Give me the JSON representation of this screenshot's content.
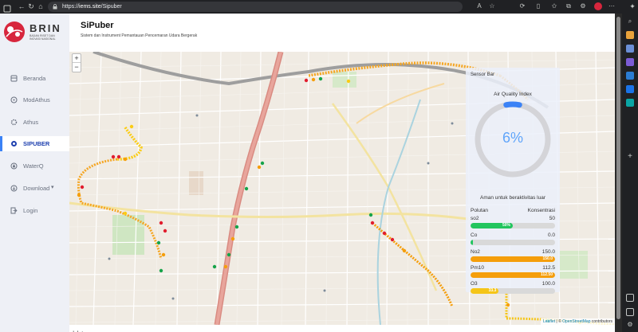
{
  "browser": {
    "url": "https://iems.site/Sipuber",
    "url_host": "https://",
    "url_domain": "iems.site",
    "url_path": "/Sipuber"
  },
  "sidebar": {
    "logo_text": "BRIN",
    "logo_sub": "BADAN RISET DAN INOVASI NASIONAL",
    "items": [
      {
        "label": "Beranda",
        "icon": "home-icon",
        "active": false
      },
      {
        "label": "ModAthus",
        "icon": "cloud-icon",
        "active": false
      },
      {
        "label": "Athus",
        "icon": "gear-icon",
        "active": false
      },
      {
        "label": "SIPUBER",
        "icon": "sensor-icon",
        "active": true
      },
      {
        "label": "WaterQ",
        "icon": "water-icon",
        "active": false
      },
      {
        "label": "Download",
        "icon": "download-icon",
        "active": false,
        "dropdown": "▾"
      },
      {
        "label": "Login",
        "icon": "login-icon",
        "active": false
      }
    ]
  },
  "header": {
    "title": "SiPuber",
    "subtitle": "Sistem dan Instrument Pemantauan Pencemaran Udara Bergerak"
  },
  "map": {
    "zoom_in": "+",
    "zoom_out": "−",
    "attribution_leaflet": "Leaflet",
    "attribution_sep": " | © ",
    "attribution_osm": "OpenStreetMap",
    "attribution_tail": " contributors"
  },
  "sensor": {
    "title": "Sensor Bar",
    "aqi_label": "Air Quality Index",
    "aqi_value": "6%",
    "aqi_fraction": 0.06,
    "status": "Aman untuk beraktivitas luar",
    "col_pollutant": "Polutan",
    "col_concentration": "Konsentrasi",
    "pollutants": [
      {
        "name": "so2",
        "value": "50",
        "bar_label": "50%",
        "fraction": 0.5,
        "color": "#22c55e"
      },
      {
        "name": "Co",
        "value": "0.0",
        "bar_label": "",
        "fraction": 0.0,
        "color": "#22c55e"
      },
      {
        "name": "No2",
        "value": "150.0",
        "bar_label": "150.0",
        "fraction": 1.0,
        "color": "#f59e0b"
      },
      {
        "name": "Pm10",
        "value": "112.5",
        "bar_label": "112.50",
        "fraction": 1.0,
        "color": "#f59e0b"
      },
      {
        "name": "O3",
        "value": "100.0",
        "bar_label": "33.3",
        "fraction": 0.333,
        "color": "#f5c518"
      }
    ]
  },
  "footer": {
    "text": "delete"
  },
  "colors": {
    "accent": "#3b82f6",
    "brand_red": "#d7263d",
    "marker_red": "#e11d2e",
    "marker_orange": "#f59e0b",
    "marker_yellow": "#facc15",
    "marker_green": "#16a34a"
  }
}
